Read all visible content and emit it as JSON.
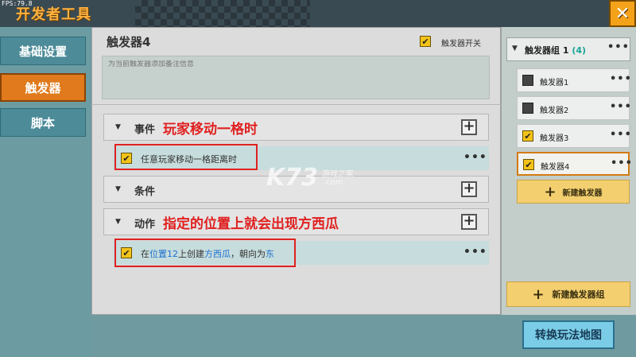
{
  "window": {
    "fps": "FPS:79.8",
    "title": "开发者工具"
  },
  "sidebar": {
    "items": [
      {
        "label": "基础设置"
      },
      {
        "label": "触发器"
      },
      {
        "label": "脚本"
      }
    ]
  },
  "main": {
    "trigger_title": "触发器4",
    "switch_label": "触发器开关",
    "note_placeholder": "为当前触发器添加备注信息",
    "sections": {
      "event": {
        "label": "事件",
        "annotation": "玩家移动一格时"
      },
      "condition": {
        "label": "条件"
      },
      "action": {
        "label": "动作",
        "annotation": "指定的位置上就会出现方西瓜"
      }
    },
    "event_row": {
      "text": "任意玩家移动一格距离时"
    },
    "action_row": {
      "p1": "在",
      "position": "位置12",
      "p2": "上创建",
      "item": "方西瓜",
      "p3": "，朝向为",
      "dir": "东"
    }
  },
  "right_panel": {
    "group": {
      "label": "触发器组 1",
      "count": "(4)"
    },
    "triggers": [
      {
        "label": "触发器1",
        "checked": false
      },
      {
        "label": "触发器2",
        "checked": false
      },
      {
        "label": "触发器3",
        "checked": true
      },
      {
        "label": "触发器4",
        "checked": true
      }
    ],
    "new_trigger": "新建触发器",
    "new_group": "新建触发器组"
  },
  "switch_map": "转换玩法地图",
  "watermark": {
    "logo": "K73",
    "sub": "游戏之家",
    "com": ".com"
  },
  "glyphs": {
    "check": "✔",
    "more": "•••",
    "plus": "+",
    "arrow": "▼",
    "close": "✕"
  },
  "colors": {
    "accent": "#e07a1c",
    "annotation": "#e02020",
    "link": "#1b6fd1",
    "checkbox": "#f3c319"
  }
}
